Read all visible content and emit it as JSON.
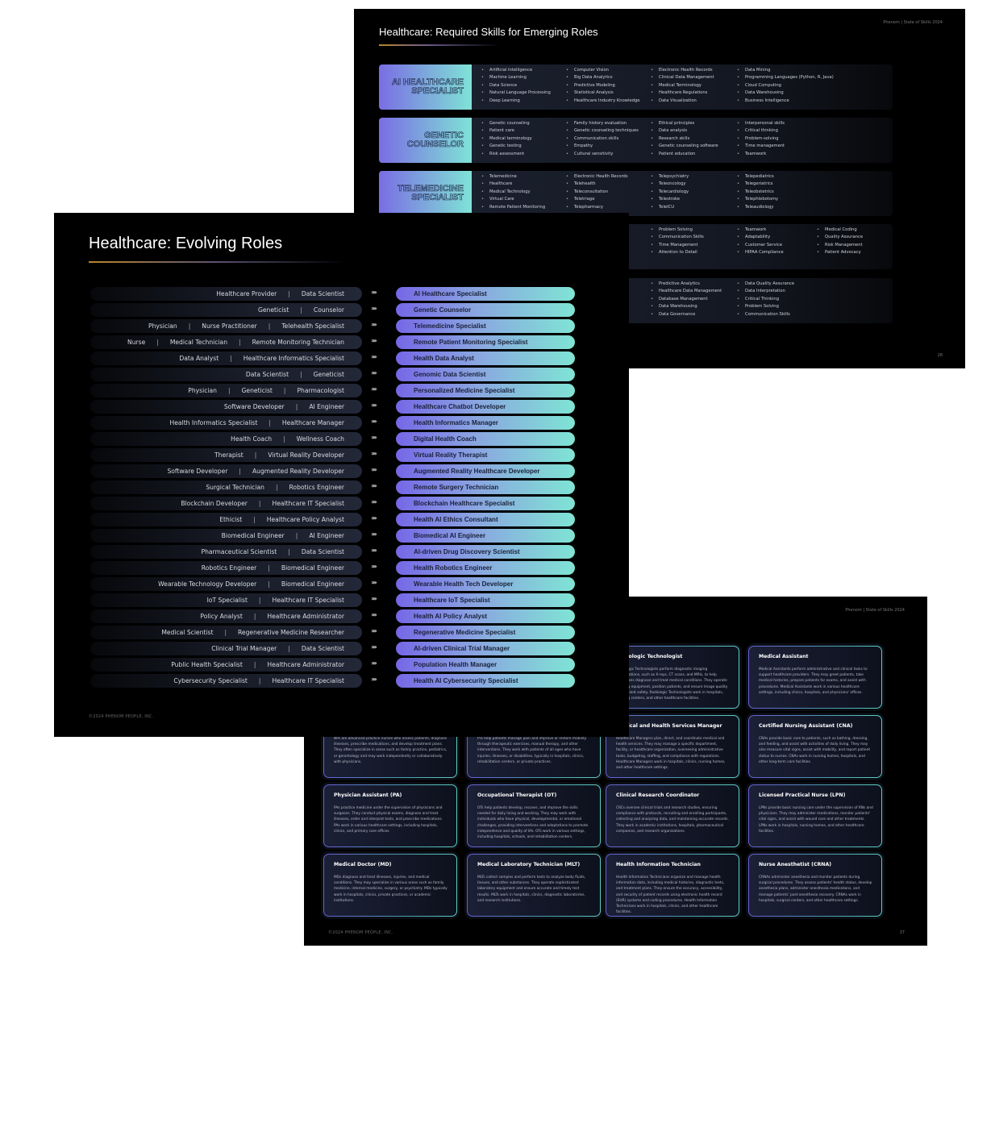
{
  "top_slide": {
    "header": "Phenom  |  State of Skills 2024",
    "title": "Healthcare: Required Skills for Emerging Roles",
    "page_number": "28",
    "rows": [
      {
        "role": "AI Healthcare Specialist",
        "columns": [
          [
            "Artificial Intelligence",
            "Machine Learning",
            "Data Science",
            "Natural Language Processing",
            "Deep Learning"
          ],
          [
            "Computer Vision",
            "Big Data Analytics",
            "Predictive Modeling",
            "Statistical Analysis",
            "Healthcare Industry Knowledge"
          ],
          [
            "Electronic Health Records",
            "Clinical Data Management",
            "Medical Terminology",
            "Healthcare Regulations",
            "Data Visualization"
          ],
          [
            "Data Mining",
            "Programming Languages (Python, R, Java)",
            "Cloud Computing",
            "Data Warehousing",
            "Business Intelligence"
          ]
        ]
      },
      {
        "role": "Genetic Counselor",
        "columns": [
          [
            "Genetic counseling",
            "Patient care",
            "Medical terminology",
            "Genetic testing",
            "Risk assessment"
          ],
          [
            "Family history evaluation",
            "Genetic counseling techniques",
            "Communication skills",
            "Empathy",
            "Cultural sensitivity"
          ],
          [
            "Ethical principles",
            "Data analysis",
            "Research skills",
            "Genetic counseling software",
            "Patient education"
          ],
          [
            "Interpersonal skills",
            "Critical thinking",
            "Problem-solving",
            "Time management",
            "Teamwork"
          ]
        ]
      },
      {
        "role": "Telemedicine Specialist",
        "columns": [
          [
            "Telemedicine",
            "Healthcare",
            "Medical Technology",
            "Virtual Care",
            "Remote Patient Monitoring"
          ],
          [
            "Electronic Health Records",
            "Telehealth",
            "Teleconsultation",
            "Teletriage",
            "Telepharmacy"
          ],
          [
            "Telepsychiatry",
            "Teleoncology",
            "Telecardiology",
            "Telestroke",
            "TeleICU"
          ],
          [
            "Telepediatrics",
            "Telegeriatrics",
            "Teleobstetrics",
            "Telephlebotomy",
            "Teleaudiology"
          ]
        ]
      },
      {
        "role": "",
        "columns": [
          [],
          [],
          [
            "Problem Solving",
            "Communication Skills",
            "Time Management",
            "Attention to Detail"
          ],
          [
            "Teamwork",
            "Adaptability",
            "Customer Service",
            "HIPAA Compliance"
          ],
          [
            "Medical Coding",
            "Quality Assurance",
            "Risk Management",
            "Patient Advocacy"
          ]
        ]
      },
      {
        "role": "",
        "columns": [
          [],
          [],
          [
            "Predictive Analytics",
            "Healthcare Data Management",
            "Database Management",
            "Data Warehousing",
            "Data Governance"
          ],
          [
            "Data Quality Assurance",
            "Data Interpretation",
            "Critical Thinking",
            "Problem Solving",
            "Communication Skills"
          ]
        ]
      }
    ]
  },
  "left_slide": {
    "title": "Healthcare: Evolving Roles",
    "footer": "©2024 PHENOM PEOPLE, INC.",
    "arrow_icon": "chevrons-right",
    "rows": [
      {
        "from": [
          "Healthcare Provider",
          "Data Scientist"
        ],
        "to": "AI Healthcare Specialist"
      },
      {
        "from": [
          "Geneticist",
          "Counselor"
        ],
        "to": "Genetic Counselor"
      },
      {
        "from": [
          "Physician",
          "Nurse Practitioner",
          "Telehealth Specialist"
        ],
        "to": "Telemedicine Specialist"
      },
      {
        "from": [
          "Nurse",
          "Medical Technician",
          "Remote Monitoring Technician"
        ],
        "to": "Remote Patient Monitoring Specialist"
      },
      {
        "from": [
          "Data Analyst",
          "Healthcare Informatics Specialist"
        ],
        "to": "Health Data Analyst"
      },
      {
        "from": [
          "Data Scientist",
          "Geneticist"
        ],
        "to": "Genomic Data Scientist"
      },
      {
        "from": [
          "Physician",
          "Geneticist",
          "Pharmacologist"
        ],
        "to": "Personalized Medicine Specialist"
      },
      {
        "from": [
          "Software Developer",
          "AI Engineer"
        ],
        "to": "Healthcare Chatbot Developer"
      },
      {
        "from": [
          "Health Informatics Specialist",
          "Healthcare Manager"
        ],
        "to": "Health Informatics Manager"
      },
      {
        "from": [
          "Health Coach",
          "Wellness Coach"
        ],
        "to": "Digital Health Coach"
      },
      {
        "from": [
          "Therapist",
          "Virtual Reality Developer"
        ],
        "to": "Virtual Reality Therapist"
      },
      {
        "from": [
          "Software Developer",
          "Augmented Reality Developer"
        ],
        "to": "Augmented Reality Healthcare Developer"
      },
      {
        "from": [
          "Surgical Technician",
          "Robotics Engineer"
        ],
        "to": "Remote Surgery Technician"
      },
      {
        "from": [
          "Blockchain Developer",
          "Healthcare IT Specialist"
        ],
        "to": "Blockchain Healthcare Specialist"
      },
      {
        "from": [
          "Ethicist",
          "Healthcare Policy Analyst"
        ],
        "to": "Health AI Ethics Consultant"
      },
      {
        "from": [
          "Biomedical Engineer",
          "AI Engineer"
        ],
        "to": "Biomedical AI Engineer"
      },
      {
        "from": [
          "Pharmaceutical Scientist",
          "Data Scientist"
        ],
        "to": "AI-driven Drug Discovery Scientist"
      },
      {
        "from": [
          "Robotics Engineer",
          "Biomedical Engineer"
        ],
        "to": "Health Robotics Engineer"
      },
      {
        "from": [
          "Wearable Technology Developer",
          "Biomedical Engineer"
        ],
        "to": "Wearable Health Tech Developer"
      },
      {
        "from": [
          "IoT Specialist",
          "Healthcare IT Specialist"
        ],
        "to": "Healthcare IoT Specialist"
      },
      {
        "from": [
          "Policy Analyst",
          "Healthcare Administrator"
        ],
        "to": "Health AI Policy Analyst"
      },
      {
        "from": [
          "Medical Scientist",
          "Regenerative Medicine Researcher"
        ],
        "to": "Regenerative Medicine Specialist"
      },
      {
        "from": [
          "Clinical Trial Manager",
          "Data Scientist"
        ],
        "to": "AI-driven Clinical Trial Manager"
      },
      {
        "from": [
          "Public Health Specialist",
          "Healthcare Administrator"
        ],
        "to": "Population Health Manager"
      },
      {
        "from": [
          "Cybersecurity Specialist",
          "Healthcare IT Specialist"
        ],
        "to": "Health AI Cybersecurity Specialist"
      }
    ]
  },
  "bottom_slide": {
    "header": "Phenom  |  State of Skills 2024",
    "footer": "©2024 PHENOM PEOPLE, INC.",
    "page_number": "37",
    "cards": [
      {
        "row": 0,
        "col": 2,
        "title": "Radiologic Technologist",
        "text": "Radiologic Technologists perform diagnostic imaging examinations, such as X-rays, CT scans, and MRIs, to help physicians diagnose and treat medical conditions. They operate imaging equipment, position patients, and ensure image quality and patient safety. Radiologic Technologists work in hospitals, imaging centers, and other healthcare facilities."
      },
      {
        "row": 0,
        "col": 3,
        "title": "Medical Assistant",
        "text": "Medical Assistants perform administrative and clinical tasks to support healthcare providers. They may greet patients, take medical histories, prepare patients for exams, and assist with procedures. Medical Assistants work in various healthcare settings, including clinics, hospitals, and physicians' offices."
      },
      {
        "row": 1,
        "col": 0,
        "title": "",
        "text": "NPs are advanced practice nurses who assess patients, diagnose illnesses, prescribe medications, and develop treatment plans. They often specialize in areas such as family practice, pediatrics, or gerontology and may work independently or collaboratively with physicians."
      },
      {
        "row": 1,
        "col": 1,
        "title": "",
        "text": "PTs help patients manage pain and improve or restore mobility through therapeutic exercises, manual therapy, and other interventions. They work with patients of all ages who have injuries, illnesses, or disabilities, typically in hospitals, clinics, rehabilitation centers, or private practices."
      },
      {
        "row": 1,
        "col": 2,
        "title": "Medical and Health Services Manager",
        "text": "Healthcare Managers plan, direct, and coordinate medical and health services. They may manage a specific department, facility, or healthcare organization, overseeing administrative tasks, budgeting, staffing, and compliance with regulations. Healthcare Managers work in hospitals, clinics, nursing homes, and other healthcare settings."
      },
      {
        "row": 1,
        "col": 3,
        "title": "Certified Nursing Assistant (CNA)",
        "text": "CNAs provide basic care to patients, such as bathing, dressing, and feeding, and assist with activities of daily living. They may also measure vital signs, assist with mobility, and report patient status to nurses. CNAs work in nursing homes, hospitals, and other long-term care facilities."
      },
      {
        "row": 2,
        "col": 0,
        "title": "Physician Assistant (PA)",
        "text": "PAs practice medicine under the supervision of physicians and surgeons. They conduct physical exams, diagnose and treat illnesses, order and interpret tests, and prescribe medications. PAs work in various healthcare settings, including hospitals, clinics, and primary care offices."
      },
      {
        "row": 2,
        "col": 1,
        "title": "Occupational Therapist (OT)",
        "text": "OTs help patients develop, recover, and improve the skills needed for daily living and working. They may work with individuals who have physical, developmental, or emotional challenges, providing interventions and adaptations to promote independence and quality of life. OTs work in various settings, including hospitals, schools, and rehabilitation centers."
      },
      {
        "row": 2,
        "col": 2,
        "title": "Clinical Research Coordinator",
        "text": "CRCs oversee clinical trials and research studies, ensuring compliance with protocols, recruiting and enrolling participants, collecting and analyzing data, and maintaining accurate records. They work in academic institutions, hospitals, pharmaceutical companies, and research organizations."
      },
      {
        "row": 2,
        "col": 3,
        "title": "Licensed Practical Nurse (LPN)",
        "text": "LPNs provide basic nursing care under the supervision of RNs and physicians. They may administer medications, monitor patients' vital signs, and assist with wound care and other treatments. LPNs work in hospitals, nursing homes, and other healthcare facilities."
      },
      {
        "row": 3,
        "col": 0,
        "title": "Medical Doctor (MD)",
        "text": "MDs diagnose and treat illnesses, injuries, and medical conditions. They may specialize in various areas such as family medicine, internal medicine, surgery, or psychiatry. MDs typically work in hospitals, clinics, private practices, or academic institutions."
      },
      {
        "row": 3,
        "col": 1,
        "title": "Medical Laboratory Technician (MLT)",
        "text": "MLTs collect samples and perform tests to analyze body fluids, tissues, and other substances. They operate sophisticated laboratory equipment and ensure accurate and timely test results. MLTs work in hospitals, clinics, diagnostic laboratories, and research institutions."
      },
      {
        "row": 3,
        "col": 2,
        "title": "Health Information Technician",
        "text": "Health Information Technicians organize and manage health information data, including medical histories, diagnostic tests, and treatment plans. They ensure the accuracy, accessibility, and security of patient records using electronic health record (EHR) systems and coding procedures. Health Information Technicians work in hospitals, clinics, and other healthcare facilities."
      },
      {
        "row": 3,
        "col": 3,
        "title": "Nurse Anesthetist (CRNA)",
        "text": "CRNAs administer anesthesia and monitor patients during surgical procedures. They assess patients' health status, develop anesthesia plans, administer anesthesia medications, and manage patients' post-anesthesia recovery. CRNAs work in hospitals, surgical centers, and other healthcare settings."
      }
    ]
  },
  "colors": {
    "accent_purple": "#7567e6",
    "accent_teal": "#7fe4d4",
    "accent_gold": "#b8862e",
    "slide_bg": "#000000"
  }
}
